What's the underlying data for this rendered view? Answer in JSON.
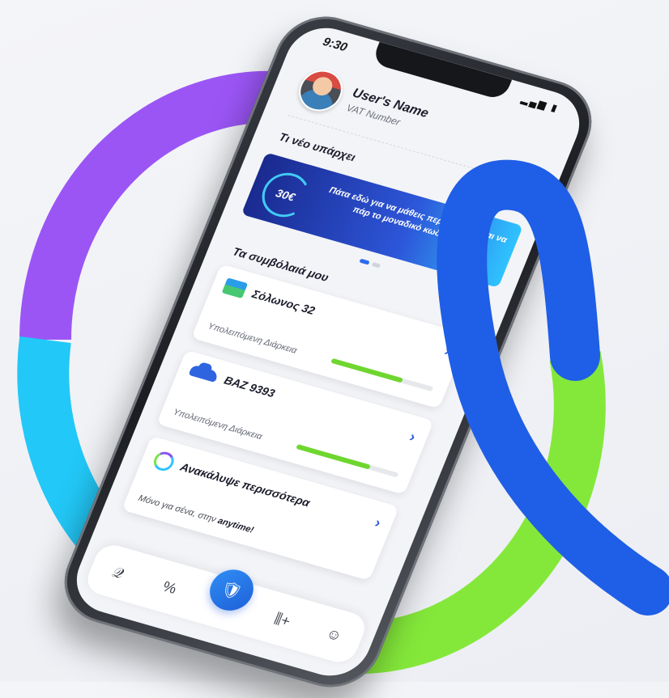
{
  "status": {
    "time": "9:30",
    "icons": "▂▄▆ ▮"
  },
  "profile": {
    "name": "User's Name",
    "vat": "VAT Number"
  },
  "news": {
    "title": "Τι νέο υπάρχει",
    "promo_badge": "30€",
    "promo_text": "Πάτα εδώ για να μάθεις περισσότερα και να πάρ το μοναδικό κωδικό σου!"
  },
  "contracts": {
    "title": "Τα συμβόλαιά μου",
    "items": [
      {
        "title": "Σόλωνος 32",
        "label": "Υπολειπόμενη Διάρκεια",
        "progress": 0.7
      },
      {
        "title": "BAZ 9393",
        "label": "Υπολειπόμενη Διάρκεια",
        "progress": 0.72
      }
    ]
  },
  "discover": {
    "title": "Ανακάλυψε περισσότερα",
    "sub_prefix": "Μόνο για σένα, στην ",
    "sub_brand": "anytime!"
  },
  "tabs": {
    "home": "𝒬",
    "offers": "%",
    "center": "🛡",
    "add": "⫼+",
    "profile": "☺"
  },
  "colors": {
    "purple": "#9b55f5",
    "cyan": "#22c8f7",
    "blue": "#1f5ee6",
    "green": "#84e83a"
  }
}
